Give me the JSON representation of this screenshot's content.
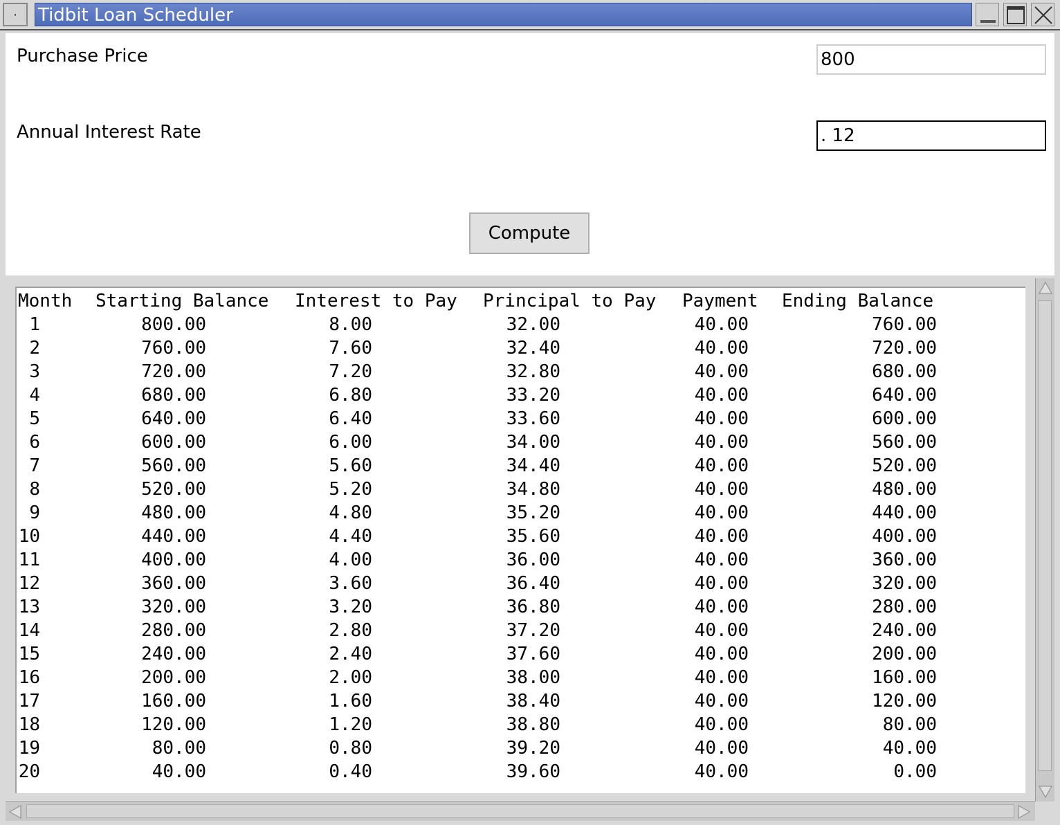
{
  "window": {
    "title": "Tidbit Loan Scheduler",
    "menu_glyph": "·"
  },
  "form": {
    "purchase_price_label": "Purchase Price",
    "purchase_price_value": "800",
    "interest_rate_label": "Annual Interest Rate",
    "interest_rate_value": ". 12",
    "compute_label": "Compute"
  },
  "schedule": {
    "headers": [
      "Month",
      "Starting Balance",
      "Interest to Pay",
      "Principal to Pay",
      "Payment",
      "Ending Balance"
    ],
    "rows": [
      [
        "1",
        "800.00",
        "8.00",
        "32.00",
        "40.00",
        "760.00"
      ],
      [
        "2",
        "760.00",
        "7.60",
        "32.40",
        "40.00",
        "720.00"
      ],
      [
        "3",
        "720.00",
        "7.20",
        "32.80",
        "40.00",
        "680.00"
      ],
      [
        "4",
        "680.00",
        "6.80",
        "33.20",
        "40.00",
        "640.00"
      ],
      [
        "5",
        "640.00",
        "6.40",
        "33.60",
        "40.00",
        "600.00"
      ],
      [
        "6",
        "600.00",
        "6.00",
        "34.00",
        "40.00",
        "560.00"
      ],
      [
        "7",
        "560.00",
        "5.60",
        "34.40",
        "40.00",
        "520.00"
      ],
      [
        "8",
        "520.00",
        "5.20",
        "34.80",
        "40.00",
        "480.00"
      ],
      [
        "9",
        "480.00",
        "4.80",
        "35.20",
        "40.00",
        "440.00"
      ],
      [
        "10",
        "440.00",
        "4.40",
        "35.60",
        "40.00",
        "400.00"
      ],
      [
        "11",
        "400.00",
        "4.00",
        "36.00",
        "40.00",
        "360.00"
      ],
      [
        "12",
        "360.00",
        "3.60",
        "36.40",
        "40.00",
        "320.00"
      ],
      [
        "13",
        "320.00",
        "3.20",
        "36.80",
        "40.00",
        "280.00"
      ],
      [
        "14",
        "280.00",
        "2.80",
        "37.20",
        "40.00",
        "240.00"
      ],
      [
        "15",
        "240.00",
        "2.40",
        "37.60",
        "40.00",
        "200.00"
      ],
      [
        "16",
        "200.00",
        "2.00",
        "38.00",
        "40.00",
        "160.00"
      ],
      [
        "17",
        "160.00",
        "1.60",
        "38.40",
        "40.00",
        "120.00"
      ],
      [
        "18",
        "120.00",
        "1.20",
        "38.80",
        "40.00",
        "80.00"
      ],
      [
        "19",
        "80.00",
        "0.80",
        "39.20",
        "40.00",
        "40.00"
      ],
      [
        "20",
        "40.00",
        "0.40",
        "39.60",
        "40.00",
        "0.00"
      ]
    ]
  }
}
